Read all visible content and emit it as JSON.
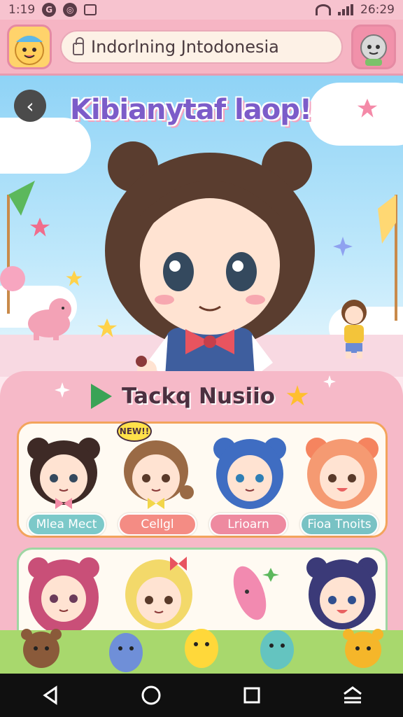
{
  "status_bar": {
    "time": "1:19",
    "right_time": "26:29",
    "icons": [
      "google-icon",
      "dnd-icon",
      "photo-icon",
      "signal-icon",
      "wifi-icon",
      "battery-icon"
    ]
  },
  "header": {
    "url_text": "Indorlning Jntodonesia",
    "left_icon": "mascot-avatar-icon",
    "right_icon": "profile-avatar-icon"
  },
  "hero": {
    "title": "Kibianytaf laop!",
    "back_icon": "back-arrow-icon"
  },
  "panel": {
    "title": "Tackq Nusiio",
    "badge": "NEW!!",
    "row1": [
      {
        "label": "Mlea Mect",
        "color": "#7cc9c9"
      },
      {
        "label": "Cellgl",
        "color": "#f48c84"
      },
      {
        "label": "Lrioarn",
        "color": "#ee8aa0"
      },
      {
        "label": "Fioa Tnoits",
        "color": "#78c2c4"
      }
    ]
  },
  "colors": {
    "header_pink": "#f6b5c4",
    "panel_pink": "#f6b9c8",
    "sky": "#8fd3f6"
  },
  "navbar": {
    "buttons": [
      "back-icon",
      "home-icon",
      "recents-icon",
      "menu-icon"
    ]
  }
}
